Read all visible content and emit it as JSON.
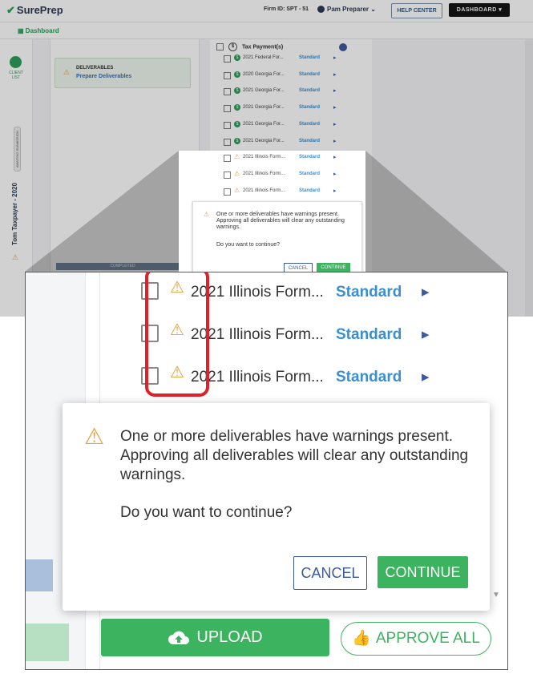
{
  "header": {
    "logo": "SurePrep",
    "firm_id": "Firm ID: SPT - 51",
    "user": "Pam Preparer",
    "help_center": "HELP CENTER",
    "dashboard_menu": "DASHBOARD"
  },
  "subnav": {
    "dashboard": "Dashboard"
  },
  "leftnav": {
    "client_list": "CLIENT LIST",
    "status": "AWAITING SUBMISSION",
    "taxpayer": "Tom Taxpayer - 2020"
  },
  "deliverables": {
    "heading": "DELIVERABLES",
    "link": "Prepare Deliverables",
    "progress_label": "COMPLETED"
  },
  "tax_payments": {
    "heading": "Tax Payment(s)",
    "rows": [
      {
        "name": "2021 Federal For...",
        "status": "Standard",
        "icon": "dollar-icon"
      },
      {
        "name": "2020 Georgia For...",
        "status": "Standard",
        "icon": "dollar-icon"
      },
      {
        "name": "2021 Georgia For...",
        "status": "Standard",
        "icon": "dollar-icon"
      },
      {
        "name": "2021 Georgia For...",
        "status": "Standard",
        "icon": "dollar-icon"
      },
      {
        "name": "2021 Georgia For...",
        "status": "Standard",
        "icon": "dollar-icon"
      },
      {
        "name": "2021 Georgia For...",
        "status": "Standard",
        "icon": "dollar-icon"
      },
      {
        "name": "2021 Illinois Form...",
        "status": "Standard",
        "icon": "warning-icon"
      },
      {
        "name": "2021 Illinois Form...",
        "status": "Standard",
        "icon": "warning-icon"
      },
      {
        "name": "2021 Illinois Form...",
        "status": "Standard",
        "icon": "warning-icon"
      }
    ]
  },
  "dialog": {
    "message": "One or more deliverables have warnings present. Approving all deliverables will clear any outstanding warnings.",
    "question": "Do you want to continue?",
    "cancel": "CANCEL",
    "continue": "CONTINUE"
  },
  "zoom": {
    "rows": [
      {
        "name": "2021 Illinois Form...",
        "status": "Standard"
      },
      {
        "name": "2021 Illinois Form...",
        "status": "Standard"
      },
      {
        "name": "2021 Illinois Form...",
        "status": "Standard"
      }
    ],
    "upload": "UPLOAD",
    "approve_all": "APPROVE ALL"
  },
  "colors": {
    "brand_green": "#3cb35f",
    "link_blue": "#3a8fd0",
    "navy": "#3d5a9e",
    "warning": "#e6a23c",
    "highlight_red": "#e0202a"
  }
}
